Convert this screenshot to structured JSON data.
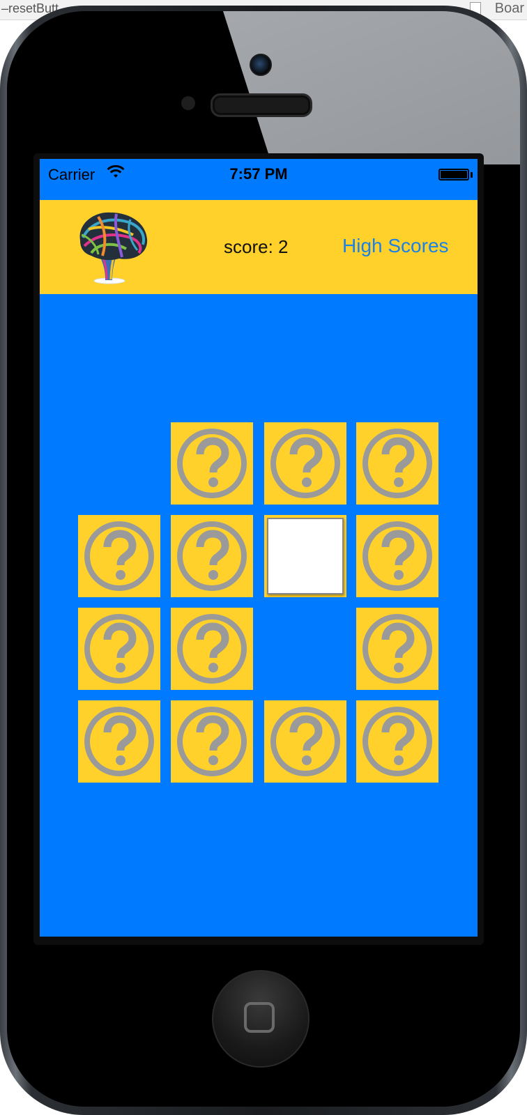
{
  "xcode": {
    "left_text": "–resetButt",
    "right_text": "Boar"
  },
  "status_bar": {
    "carrier": "Carrier",
    "time": "7:57 PM"
  },
  "header": {
    "score_label": "score: 2",
    "high_scores_label": "High Scores"
  },
  "colors": {
    "screen_background": "#007aff",
    "header_background": "#ffd12a",
    "card_background": "#ffd12a",
    "card_symbol": "#9a9a9a",
    "link_text": "#1a82e6"
  },
  "icons": {
    "card_back": "question-circle-icon",
    "logo": "brain-logo-icon",
    "wifi": "wifi-icon",
    "battery": "battery-icon"
  },
  "grid": {
    "rows": 4,
    "cols": 4,
    "cards": [
      {
        "row": 0,
        "col": 0,
        "state": "matched"
      },
      {
        "row": 0,
        "col": 1,
        "state": "hidden"
      },
      {
        "row": 0,
        "col": 2,
        "state": "hidden"
      },
      {
        "row": 0,
        "col": 3,
        "state": "hidden"
      },
      {
        "row": 1,
        "col": 0,
        "state": "hidden"
      },
      {
        "row": 1,
        "col": 1,
        "state": "hidden"
      },
      {
        "row": 1,
        "col": 2,
        "state": "revealed"
      },
      {
        "row": 1,
        "col": 3,
        "state": "hidden"
      },
      {
        "row": 2,
        "col": 0,
        "state": "hidden"
      },
      {
        "row": 2,
        "col": 1,
        "state": "hidden"
      },
      {
        "row": 2,
        "col": 2,
        "state": "matched"
      },
      {
        "row": 2,
        "col": 3,
        "state": "hidden"
      },
      {
        "row": 3,
        "col": 0,
        "state": "hidden"
      },
      {
        "row": 3,
        "col": 1,
        "state": "hidden"
      },
      {
        "row": 3,
        "col": 2,
        "state": "hidden"
      },
      {
        "row": 3,
        "col": 3,
        "state": "hidden"
      }
    ]
  }
}
